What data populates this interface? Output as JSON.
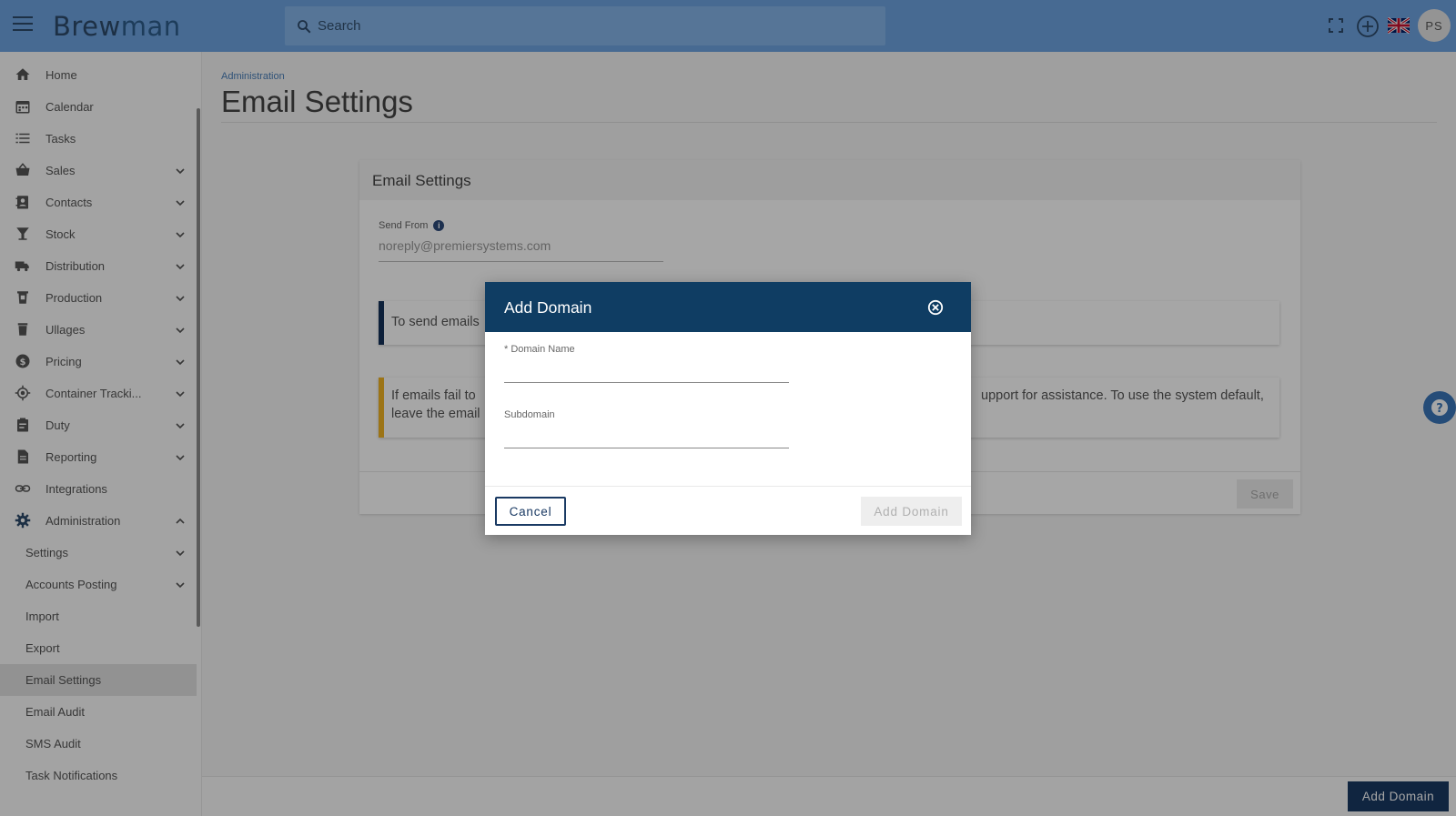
{
  "app": {
    "logo_part1": "Brew",
    "logo_part2": "man",
    "search_placeholder": "Search",
    "user_initials": "PS"
  },
  "sidebar": {
    "items": [
      {
        "label": "Home",
        "icon": "home-icon",
        "expandable": false
      },
      {
        "label": "Calendar",
        "icon": "calendar-icon",
        "expandable": false
      },
      {
        "label": "Tasks",
        "icon": "list-icon",
        "expandable": false
      },
      {
        "label": "Sales",
        "icon": "basket-icon",
        "expandable": true
      },
      {
        "label": "Contacts",
        "icon": "contacts-icon",
        "expandable": true
      },
      {
        "label": "Stock",
        "icon": "glass-icon",
        "expandable": true
      },
      {
        "label": "Distribution",
        "icon": "truck-icon",
        "expandable": true
      },
      {
        "label": "Production",
        "icon": "production-icon",
        "expandable": true
      },
      {
        "label": "Ullages",
        "icon": "bin-icon",
        "expandable": true
      },
      {
        "label": "Pricing",
        "icon": "dollar-icon",
        "expandable": true
      },
      {
        "label": "Container Tracki...",
        "icon": "target-icon",
        "expandable": true
      },
      {
        "label": "Duty",
        "icon": "clipboard-icon",
        "expandable": true
      },
      {
        "label": "Reporting",
        "icon": "document-icon",
        "expandable": true
      },
      {
        "label": "Integrations",
        "icon": "link-icon",
        "expandable": false
      },
      {
        "label": "Administration",
        "icon": "gear-icon",
        "expandable": true,
        "expanded": true
      }
    ],
    "sub_items": [
      {
        "label": "Settings",
        "expandable": true
      },
      {
        "label": "Accounts Posting",
        "expandable": true
      },
      {
        "label": "Import",
        "expandable": false
      },
      {
        "label": "Export",
        "expandable": false
      },
      {
        "label": "Email Settings",
        "expandable": false,
        "active": true
      },
      {
        "label": "Email Audit",
        "expandable": false
      },
      {
        "label": "SMS Audit",
        "expandable": false
      },
      {
        "label": "Task Notifications",
        "expandable": false
      }
    ]
  },
  "main": {
    "breadcrumb": "Administration",
    "title": "Email Settings",
    "card": {
      "title": "Email Settings",
      "send_from_label": "Send From",
      "send_from_value": "noreply@premiersystems.com",
      "notice_blue": "To send emails",
      "notice_yellow_line1": "If emails fail to",
      "notice_yellow_line2": "leave the email",
      "notice_yellow_right": "upport for assistance. To use the system default,",
      "save_label": "Save"
    },
    "bottom_button": "Add Domain"
  },
  "modal": {
    "title": "Add Domain",
    "domain_name_label": "* Domain Name",
    "domain_name_value": "",
    "subdomain_label": "Subdomain",
    "subdomain_value": "",
    "cancel_label": "Cancel",
    "add_label": "Add Domain"
  },
  "colors": {
    "topbar": "#6da3e0",
    "modal_header": "#0f3d63",
    "primary": "#1a3a63",
    "warning": "#f0b323"
  }
}
